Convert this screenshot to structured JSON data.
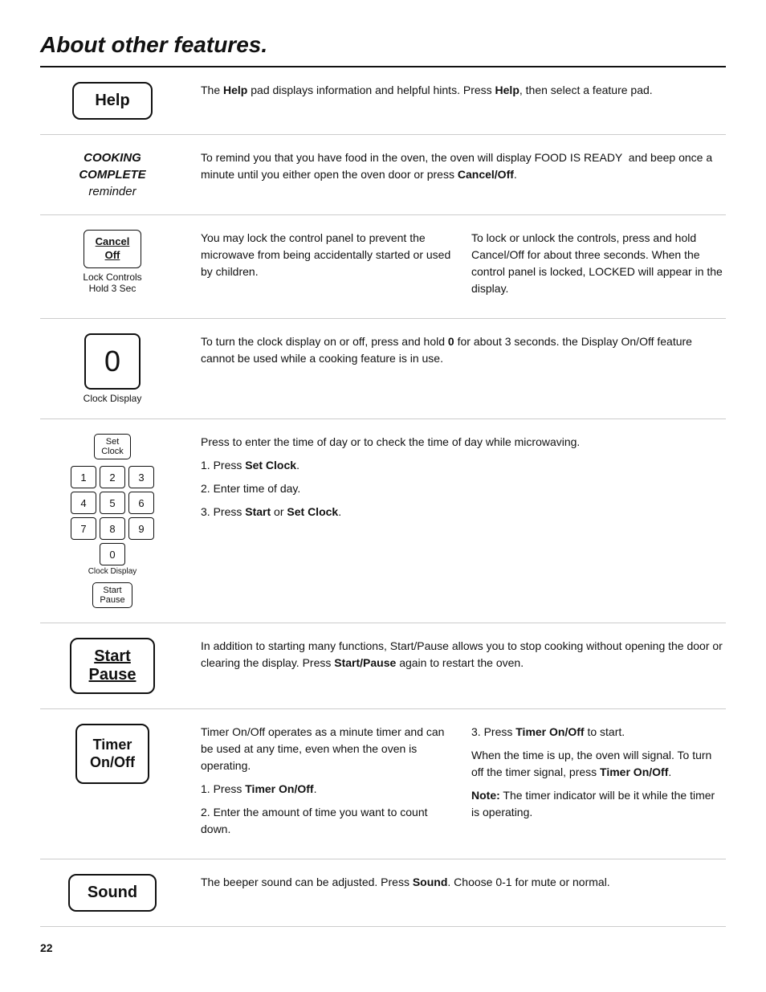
{
  "page": {
    "title": "About other features.",
    "page_number": "22"
  },
  "sections": {
    "help": {
      "button_label": "Help",
      "description": "The Help pad displays information and helpful hints. Press Help, then select a feature pad."
    },
    "cooking_complete": {
      "left_label_line1": "COOKING",
      "left_label_line2": "COMPLETE",
      "left_label_line3": "reminder",
      "description": "To remind you that you have food in the oven, the oven will display FOOD IS READY  and beep once a minute until you either open the oven door or press Cancel/Off."
    },
    "lock_controls": {
      "button_line1": "Cancel",
      "button_line2": "Off",
      "button_label": "Lock Controls",
      "button_sublabel": "Hold 3 Sec",
      "col1": "You may lock the control panel to prevent the microwave from being accidentally started or used by children.",
      "col2": "To lock or unlock the controls, press and hold Cancel/Off for about three seconds. When the control panel is locked, LOCKED will appear in the display."
    },
    "clock_display": {
      "zero_label": "0",
      "bottom_label": "Clock Display",
      "description": "To turn the clock display on or off, press and hold 0 for about 3 seconds. the Display On/Off feature cannot be used while a cooking feature is in use."
    },
    "set_clock": {
      "set_clock_btn": "Set Clock",
      "numpad": [
        [
          "1",
          "2",
          "3"
        ],
        [
          "4",
          "5",
          "6"
        ],
        [
          "7",
          "8",
          "9"
        ]
      ],
      "zero": "0",
      "clock_display_label": "Clock Display",
      "start_pause_btn": "Start Pause",
      "intro": "Press to enter the time of day or to check the time of day while microwaving.",
      "step1": "1. Press Set Clock.",
      "step2": "2. Enter time of day.",
      "step3": "3. Press Start or Set Clock."
    },
    "start_pause": {
      "button_line1": "Start",
      "button_line2": "Pause",
      "description": "In addition to starting many functions, Start/Pause allows you to stop cooking without opening the door or clearing the display. Press Start/Pause again to restart the oven."
    },
    "timer_onoff": {
      "button_line1": "Timer",
      "button_line2": "On/Off",
      "col1_intro": "Timer On/Off operates as a minute timer and can be used at any time, even when the oven is operating.",
      "col1_step1": "1. Press Timer On/Off.",
      "col1_step2": "2. Enter the amount of time you want to count down.",
      "col2_step3": "3. Press Timer On/Off to start.",
      "col2_signal": "When the time is up, the oven will signal. To turn off the timer signal, press Timer On/Off.",
      "col2_note": "Note: The timer indicator will be it while the timer is operating."
    },
    "sound": {
      "button_label": "Sound",
      "description": "The beeper sound can be adjusted. Press Sound. Choose 0-1 for mute or normal."
    }
  }
}
